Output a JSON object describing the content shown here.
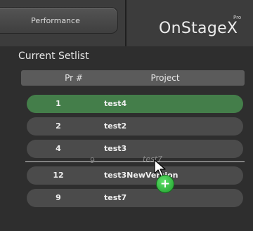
{
  "header": {
    "tab_label": "Performance",
    "logo": "OnStageX",
    "logo_superscript": "Pro"
  },
  "setlist": {
    "title": "Current Setlist",
    "columns": [
      "Pr #",
      "Project"
    ],
    "rows": [
      {
        "number": "1",
        "project": "test4",
        "selected": true
      },
      {
        "number": "2",
        "project": "test2",
        "selected": false
      },
      {
        "number": "4",
        "project": "test3",
        "selected": false
      },
      {
        "number": "12",
        "project": "test3NewVersion",
        "selected": false
      },
      {
        "number": "9",
        "project": "test7",
        "selected": false
      }
    ]
  },
  "drag": {
    "ghost_number": "9",
    "ghost_project": "test7",
    "add_badge_symbol": "+"
  },
  "colors": {
    "selected_row": "#447e4a",
    "row": "#4b4b4b",
    "header_row": "#5b5b5b",
    "add_badge": "#2fbf3c"
  },
  "icons": [
    "arrow-cursor-icon",
    "plus-icon"
  ]
}
